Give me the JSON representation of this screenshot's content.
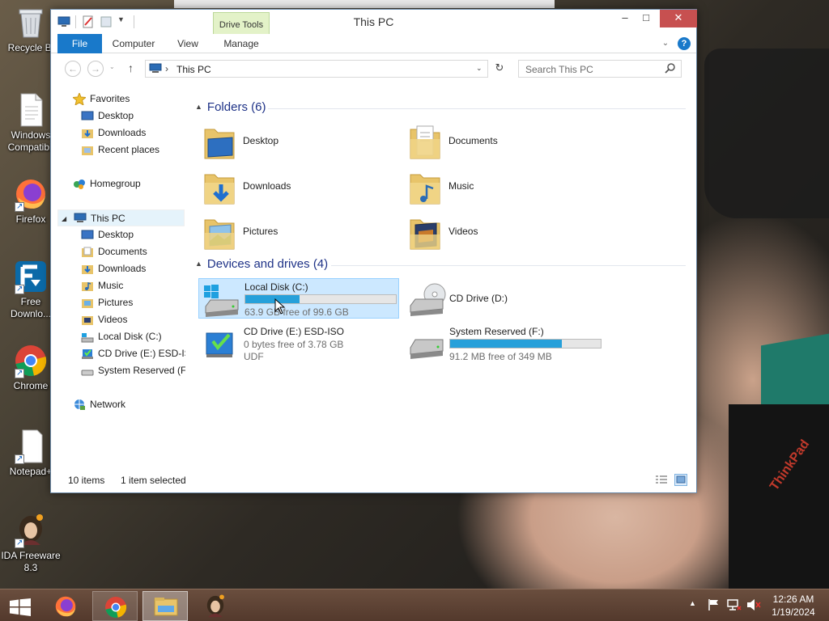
{
  "desktop": {
    "icons": [
      {
        "label": "Recycle Bi",
        "icon": "recycle-bin-icon"
      },
      {
        "label": "Windows Compatibil",
        "icon": "document-icon"
      },
      {
        "label": "Firefox",
        "icon": "firefox-icon"
      },
      {
        "label": "Free Downlo...",
        "icon": "download-manager-icon"
      },
      {
        "label": "Chrome",
        "icon": "chrome-icon"
      },
      {
        "label": "Notepad+",
        "icon": "notepad-icon"
      },
      {
        "label": "IDA Freeware 8.3",
        "icon": "ida-icon"
      }
    ],
    "brand_text": "ThinkPad"
  },
  "window": {
    "title": "This PC",
    "context_tab": "Drive Tools",
    "controls": {
      "minimize": "–",
      "maximize": "□",
      "close": "✕"
    },
    "ribbon_tabs": [
      "File",
      "Computer",
      "View",
      "Manage"
    ],
    "help": "?",
    "address": {
      "path": "This PC",
      "separator": "›"
    },
    "search": {
      "placeholder": "Search This PC"
    }
  },
  "nav": {
    "favorites": {
      "label": "Favorites",
      "items": [
        "Desktop",
        "Downloads",
        "Recent places"
      ]
    },
    "homegroup": "Homegroup",
    "thispc": {
      "label": "This PC",
      "items": [
        "Desktop",
        "Documents",
        "Downloads",
        "Music",
        "Pictures",
        "Videos",
        "Local Disk (C:)",
        "CD Drive (E:) ESD-ISO",
        "System Reserved (F:)"
      ]
    },
    "network": "Network"
  },
  "content": {
    "folders_header": "Folders (6)",
    "folders": [
      "Desktop",
      "Documents",
      "Downloads",
      "Music",
      "Pictures",
      "Videos"
    ],
    "drives_header": "Devices and drives (4)",
    "drives": [
      {
        "name": "Local Disk (C:)",
        "free": "63.9 GB free of 99.6 GB",
        "used_fraction": 0.36,
        "selected": true
      },
      {
        "name": "CD Drive (D:)"
      },
      {
        "name": "CD Drive (E:) ESD-ISO",
        "free": "0 bytes free of 3.78 GB",
        "fs": "UDF"
      },
      {
        "name": "System Reserved (F:)",
        "free": "91.2 MB free of 349 MB",
        "used_fraction": 0.74
      }
    ]
  },
  "status": {
    "items": "10 items",
    "selection": "1 item selected"
  },
  "taskbar": {
    "apps": [
      "start-icon",
      "firefox-icon",
      "chrome-icon",
      "file-explorer-icon",
      "ida-icon"
    ],
    "tray": [
      "show-hidden-icons",
      "flag-icon",
      "network-icon",
      "volume-muted-icon"
    ],
    "time": "12:26 AM",
    "date": "1/19/2024"
  },
  "colors": {
    "accent": "#1979ca",
    "selection": "#cce8ff",
    "drive_bar": "#26a0da",
    "close": "#c75050"
  }
}
